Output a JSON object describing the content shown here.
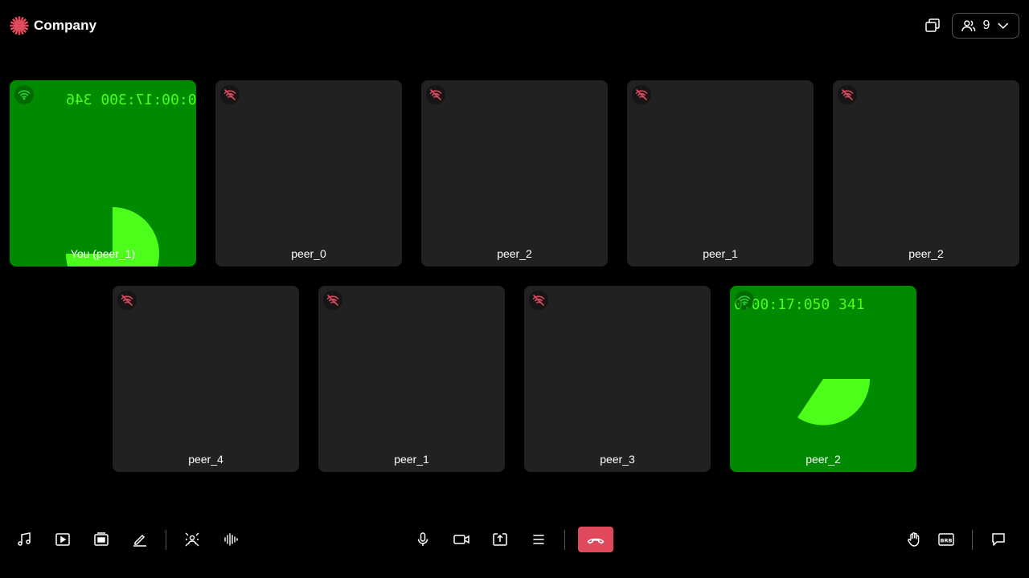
{
  "brand": {
    "name": "Company",
    "color": "#e0495b"
  },
  "header": {
    "participant_count": "9",
    "icons": [
      "pip-icon",
      "participants-icon",
      "chevron-down-icon"
    ]
  },
  "tiles": [
    {
      "name": "You (peer_1)",
      "video": true,
      "network": "good",
      "timestamp": "0:00:17:300 346",
      "mirrored": true
    },
    {
      "name": "peer_0",
      "video": false,
      "network": "poor"
    },
    {
      "name": "peer_2",
      "video": false,
      "network": "poor"
    },
    {
      "name": "peer_1",
      "video": false,
      "network": "poor"
    },
    {
      "name": "peer_2",
      "video": false,
      "network": "poor"
    },
    {
      "name": "peer_4",
      "video": false,
      "network": "poor"
    },
    {
      "name": "peer_1",
      "video": false,
      "network": "poor"
    },
    {
      "name": "peer_3",
      "video": false,
      "network": "poor"
    },
    {
      "name": "peer_2",
      "video": true,
      "network": "good",
      "timestamp": "0:00:17:050 341",
      "mirrored": false
    }
  ],
  "toolbar": {
    "left": [
      "music-icon",
      "play-video-icon",
      "slides-icon",
      "whiteboard-icon",
      "virtual-background-icon",
      "noise-suppression-icon"
    ],
    "center": [
      "microphone-icon",
      "camera-icon",
      "screen-share-icon",
      "more-menu-icon",
      "leave-call-icon"
    ],
    "right": [
      "raise-hand-icon",
      "brb-icon",
      "chat-icon"
    ],
    "brb_label": "BRB"
  },
  "colors": {
    "video_bg": "#008a00",
    "video_fg": "#4cff1a",
    "tile_bg": "#212121",
    "poor_network": "#e0495b",
    "good_network": "#2ecc40"
  }
}
